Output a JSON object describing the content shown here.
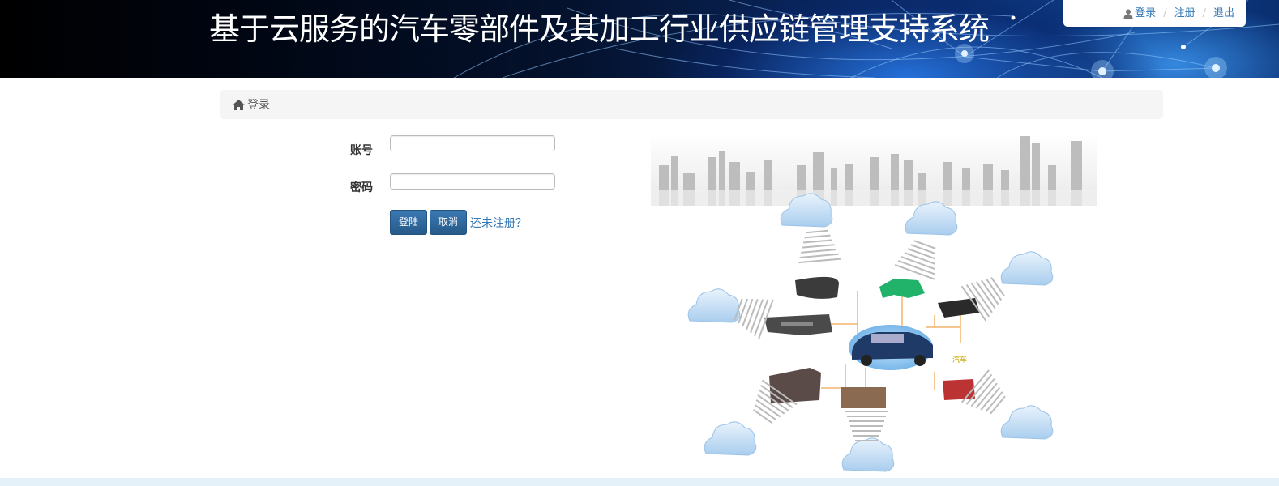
{
  "header": {
    "title": "基于云服务的汽车零部件及其加工行业供应链管理支持系统",
    "nav": {
      "login": "登录",
      "register": "注册",
      "logout": "退出",
      "separator": "/"
    }
  },
  "breadcrumb": {
    "current": "登录"
  },
  "form": {
    "account_label": "账号",
    "account_value": "",
    "password_label": "密码",
    "password_value": "",
    "login_button": "登陆",
    "cancel_button": "取消",
    "register_link": "还未注册？"
  },
  "illustration": {
    "center_label": "汽车"
  },
  "colors": {
    "link": "#337ab7",
    "button": "#2d6ca2",
    "breadcrumb_bg": "#f5f5f5",
    "footer_strip": "#e4f1f8"
  },
  "icons": [
    "user-icon",
    "home-icon",
    "cloud-icon",
    "car-image",
    "city-skyline"
  ]
}
